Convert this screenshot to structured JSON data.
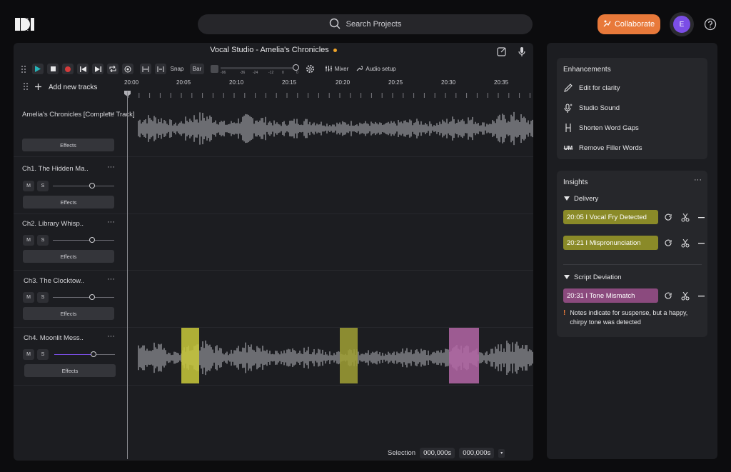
{
  "search": {
    "placeholder": "Search Projects"
  },
  "header": {
    "collaborate_label": "Collaborate",
    "avatar_initial": "E"
  },
  "editor": {
    "title": "Vocal Studio - Amelia's Chronicles",
    "unsaved": true,
    "toolbar": {
      "snap_label": "Snap",
      "bar_label": "Bar",
      "mixer_label": "Mixer",
      "audio_setup_label": "Audio setup",
      "meter_labels": [
        "-96",
        "-36",
        "-24",
        "-12",
        "0",
        "0"
      ]
    },
    "add_tracks_label": "Add new tracks",
    "ruler": [
      "20:00",
      "20:05",
      "20:10",
      "20:15",
      "20:20",
      "20:25",
      "20:30",
      "20:35"
    ],
    "tracks": [
      {
        "name": "Amelia's Chronicles [Complete Track]",
        "effects_label": "Effects",
        "has_audio": true
      },
      {
        "name": "Ch1. The Hidden Ma..",
        "mute": "M",
        "solo": "S",
        "effects_label": "Effects",
        "volume": 0.8
      },
      {
        "name": "Ch2. Library Whisp..",
        "mute": "M",
        "solo": "S",
        "effects_label": "Effects",
        "volume": 0.8
      },
      {
        "name": "Ch3. The Clocktow..",
        "mute": "M",
        "solo": "S",
        "effects_label": "Effects",
        "volume": 0.8
      },
      {
        "name": "Ch4. Moonlit Mess..",
        "mute": "M",
        "solo": "S",
        "effects_label": "Effects",
        "volume": 0.8,
        "has_audio": true
      }
    ],
    "selection": {
      "label": "Selection",
      "start": "000,000s",
      "end": "000,000s"
    }
  },
  "enhancements": {
    "title": "Enhancements",
    "items": [
      {
        "label": "Edit for clarity",
        "icon": "pencil-icon"
      },
      {
        "label": "Studio Sound",
        "icon": "mic-sparkle-icon"
      },
      {
        "label": "Shorten Word Gaps",
        "icon": "gap-icon"
      },
      {
        "label": "Remove Filler Words",
        "icon": "strikethrough-um-icon"
      }
    ],
    "um_glyph": "UM"
  },
  "insights": {
    "title": "Insights",
    "sections": [
      {
        "label": "Delivery",
        "tags": [
          {
            "label": "20:05 I Vocal Fry Detected",
            "color": "#8a8a28"
          },
          {
            "label": "20:21 I Mispronunciation",
            "color": "#8a8a28"
          }
        ]
      },
      {
        "label": "Script Deviation",
        "tags": [
          {
            "label": "20:31 I Tone Mismatch",
            "color": "#8b4a7e"
          }
        ],
        "note": "Notes indicate for suspense, but a happy, chirpy tone was detected"
      }
    ]
  },
  "colors": {
    "accent": "#e8793a",
    "avatar": "#7b4ee6",
    "delivery_tag": "#8a8a28",
    "deviation_tag": "#8b4a7e",
    "highlight_yellow": "#c9c93a",
    "highlight_pink": "#b466a6"
  }
}
